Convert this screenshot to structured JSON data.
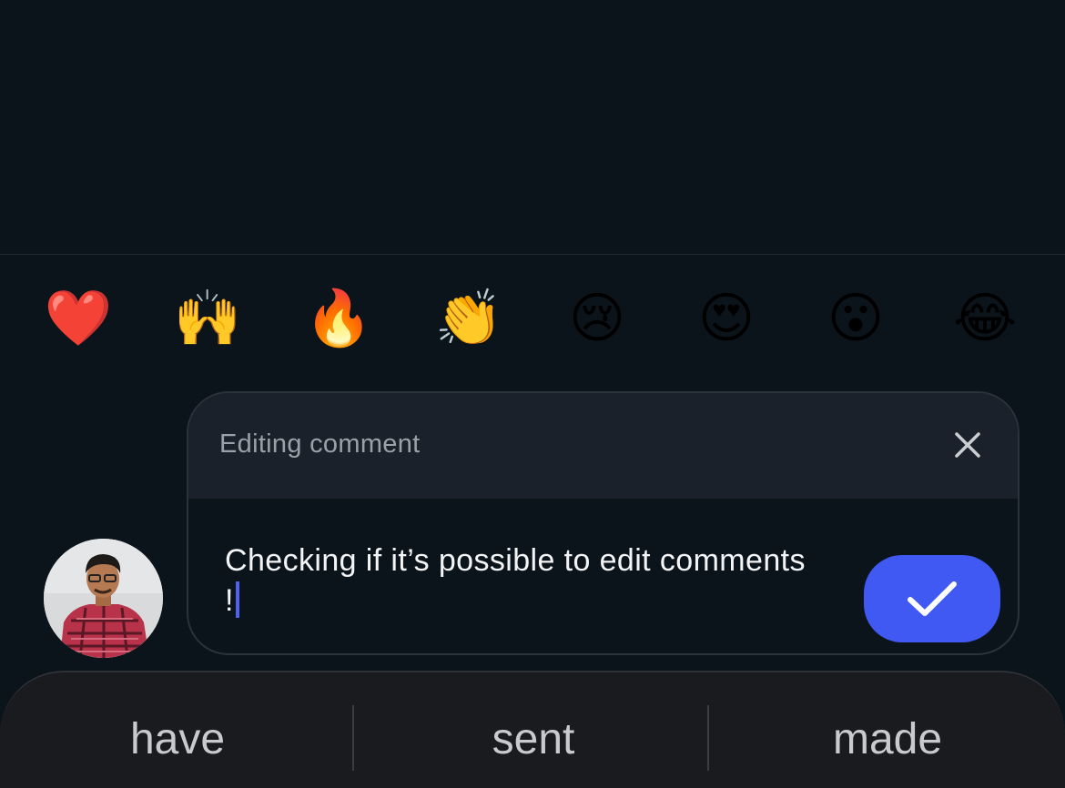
{
  "reactions": [
    {
      "emoji": "❤️",
      "icon": "heart-icon"
    },
    {
      "emoji": "🙌",
      "icon": "raised-hands-icon"
    },
    {
      "emoji": "🔥",
      "icon": "fire-icon"
    },
    {
      "emoji": "👏",
      "icon": "clapping-hands-icon"
    },
    {
      "emoji": "😢",
      "icon": "crying-face-icon"
    },
    {
      "emoji": "😍",
      "icon": "heart-eyes-icon"
    },
    {
      "emoji": "😮",
      "icon": "surprised-face-icon"
    },
    {
      "emoji": "😂",
      "icon": "tears-of-joy-icon"
    }
  ],
  "editor": {
    "title": "Editing comment",
    "comment_text": "Checking if it’s possible to edit comments !",
    "close_icon": "close-icon",
    "submit_icon": "checkmark-icon"
  },
  "keyboard": {
    "suggestions": [
      "have",
      "sent",
      "made"
    ]
  },
  "colors": {
    "background": "#0c141b",
    "header_bg": "#1a212a",
    "accent": "#4059f2",
    "caret": "#4f63f0",
    "keyboard_bg": "#191b1f"
  }
}
